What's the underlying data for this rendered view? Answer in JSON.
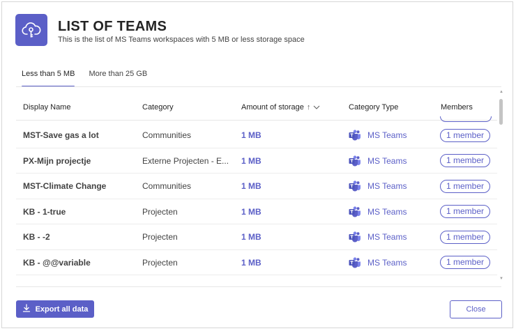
{
  "header": {
    "title": "LIST OF TEAMS",
    "subtitle": "This is the list of MS Teams workspaces with 5 MB or less storage space",
    "icon": "cloud-key-icon"
  },
  "tabs": [
    {
      "label": "Less than 5 MB",
      "active": true
    },
    {
      "label": "More than 25 GB",
      "active": false
    }
  ],
  "table": {
    "columns": {
      "display_name": "Display Name",
      "category": "Category",
      "storage": "Amount of storage",
      "storage_sort": "↑",
      "category_type": "Category Type",
      "members": "Members"
    },
    "rows": [
      {
        "name": "MST-Save gas a lot",
        "category": "Communities",
        "storage": "1 MB",
        "type": "MS Teams",
        "members": "1 member"
      },
      {
        "name": "PX-Mijn projectje",
        "category": "Externe Projecten - E...",
        "storage": "1 MB",
        "type": "MS Teams",
        "members": "1 member"
      },
      {
        "name": "MST-Climate Change",
        "category": "Communities",
        "storage": "1 MB",
        "type": "MS Teams",
        "members": "1 member"
      },
      {
        "name": "KB - 1-true",
        "category": "Projecten",
        "storage": "1 MB",
        "type": "MS Teams",
        "members": "1 member"
      },
      {
        "name": "KB - -2",
        "category": "Projecten",
        "storage": "1 MB",
        "type": "MS Teams",
        "members": "1 member"
      },
      {
        "name": "KB - @@variable",
        "category": "Projecten",
        "storage": "1 MB",
        "type": "MS Teams",
        "members": "1 member"
      }
    ]
  },
  "footer": {
    "export_label": "Export all data",
    "close_label": "Close"
  },
  "colors": {
    "accent": "#5b5fc7",
    "text": "#242424",
    "border": "#e6e6e6"
  }
}
